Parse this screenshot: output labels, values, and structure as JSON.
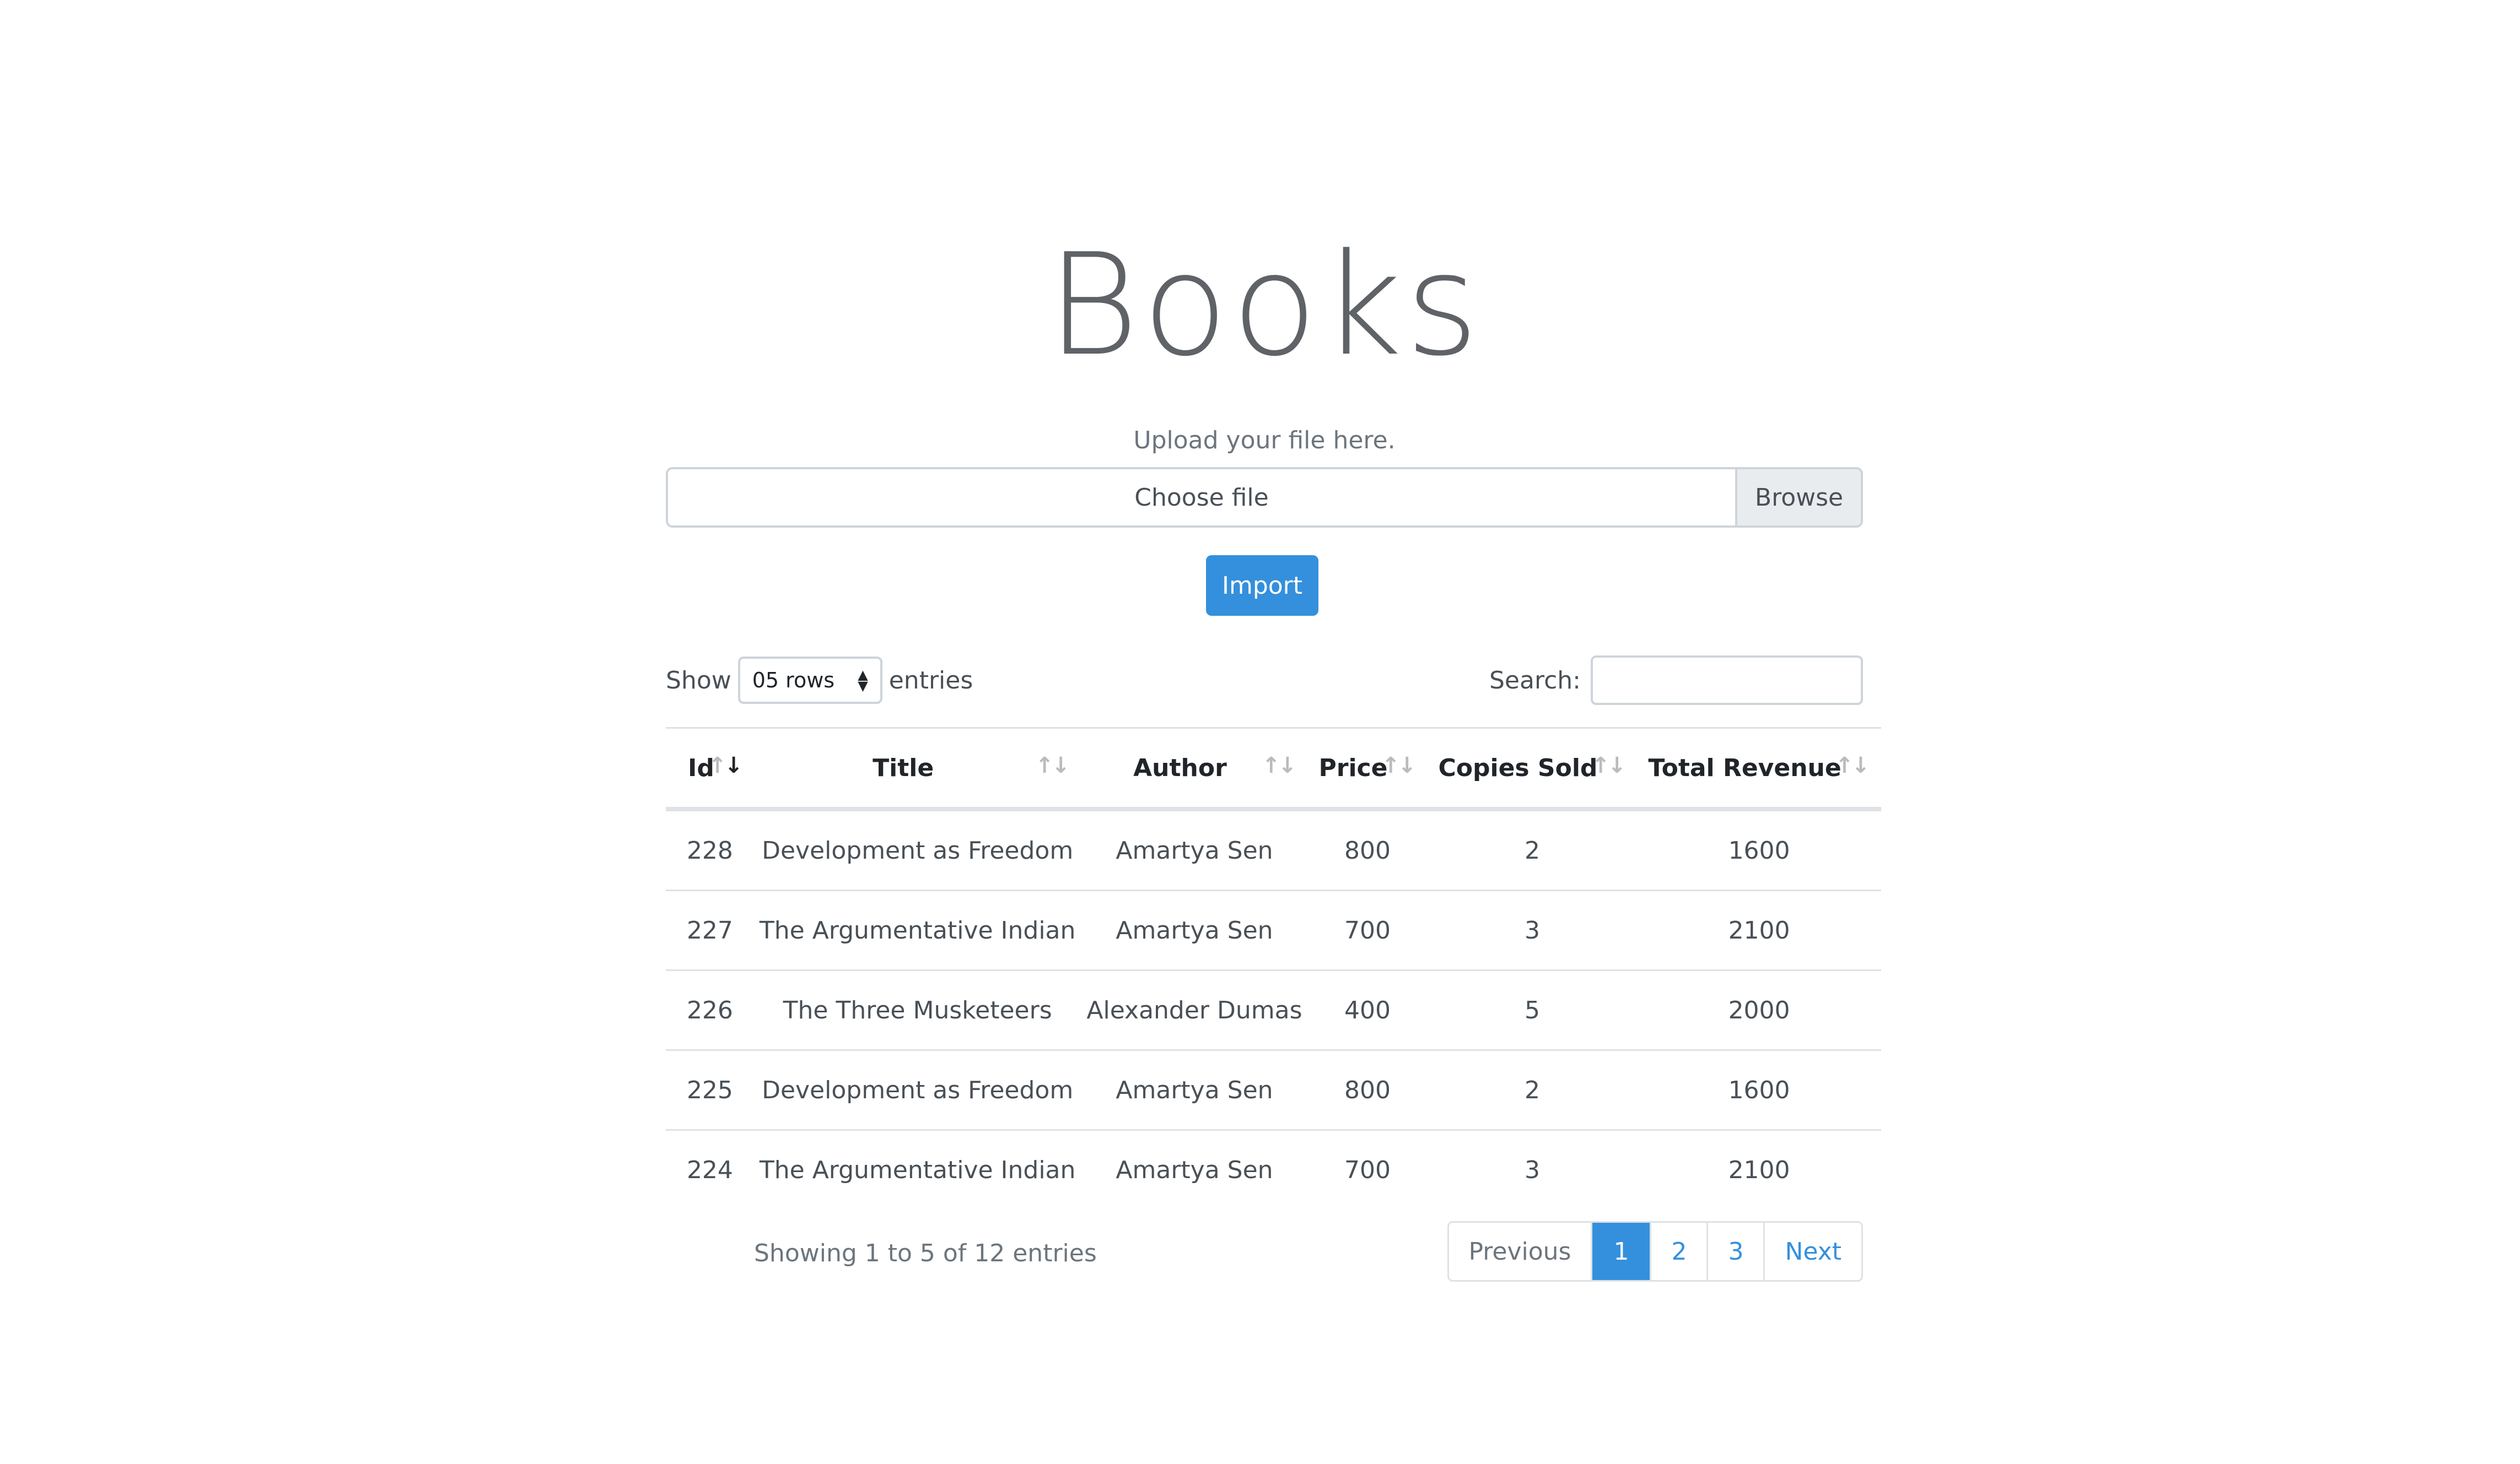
{
  "page": {
    "title": "Books"
  },
  "upload": {
    "hint": "Upload your file here.",
    "file_label": "Choose file",
    "browse_label": "Browse",
    "import_label": "Import"
  },
  "length_control": {
    "prefix": "Show",
    "selected": "05 rows",
    "suffix": "entries"
  },
  "search": {
    "label": "Search:",
    "value": ""
  },
  "table": {
    "columns": [
      "Id",
      "Title",
      "Author",
      "Price",
      "Copies Sold",
      "Total Revenue"
    ],
    "sorted_column": "Id",
    "rows": [
      [
        "228",
        "Development as Freedom",
        "Amartya Sen",
        "800",
        "2",
        "1600"
      ],
      [
        "227",
        "The Argumentative Indian",
        "Amartya Sen",
        "700",
        "3",
        "2100"
      ],
      [
        "226",
        "The Three Musketeers",
        "Alexander Dumas",
        "400",
        "5",
        "2000"
      ],
      [
        "225",
        "Development as Freedom",
        "Amartya Sen",
        "800",
        "2",
        "1600"
      ],
      [
        "224",
        "The Argumentative Indian",
        "Amartya Sen",
        "700",
        "3",
        "2100"
      ]
    ]
  },
  "info": "Showing 1 to 5 of 12 entries",
  "pagination": {
    "previous": "Previous",
    "pages": [
      "1",
      "2",
      "3"
    ],
    "active_page": "1",
    "next": "Next"
  },
  "colors": {
    "primary": "#3490dc",
    "title": "#5f6368",
    "border": "#dee2e6"
  },
  "icons": {
    "sort": "sort-arrows-icon",
    "select": "select-arrows-icon"
  }
}
